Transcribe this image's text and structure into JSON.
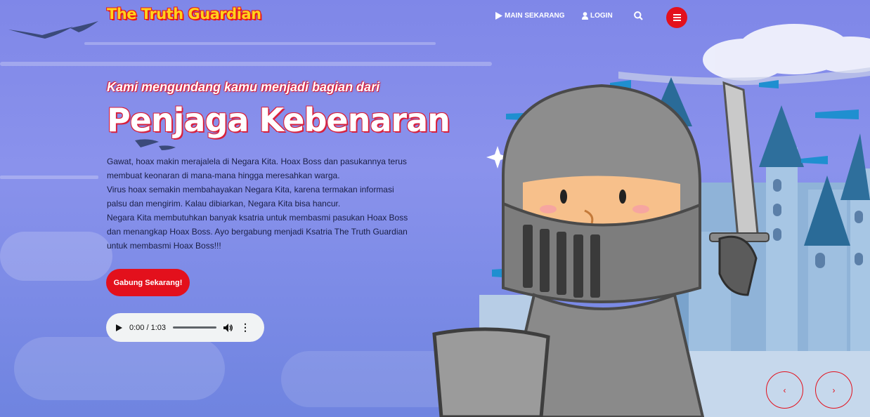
{
  "nav": {
    "logo": "The Truth Guardian",
    "play_label": "MAIN SEKARANG",
    "login_label": "LOGIN"
  },
  "hero": {
    "subtitle": "Kami mengundang kamu menjadi bagian dari",
    "title": "Penjaga Kebenaran",
    "paragraphs": [
      "Gawat, hoax makin merajalela di Negara Kita. Hoax Boss dan pasukannya terus membuat keonaran di mana-mana hingga meresahkan warga.",
      "Virus hoax semakin membahayakan Negara Kita, karena termakan informasi palsu dan mengirim. Kalau dibiarkan, Negara Kita bisa hancur.",
      "Negara Kita membutuhkan banyak ksatria untuk membasmi pasukan Hoax Boss dan menangkap Hoax Boss. Ayo bergabung menjadi Ksatria The Truth Guardian untuk membasmi Hoax Boss!!!"
    ],
    "cta_label": "Gabung Sekarang!"
  },
  "audio": {
    "time": "0:00 / 1:03",
    "progress": 0
  },
  "colors": {
    "accent": "#e3101c",
    "logo_yellow": "#ffd21c",
    "sky": "#8088e8"
  },
  "icons": {
    "play": "play-icon",
    "user": "user-icon",
    "search": "search-icon",
    "menu": "hamburger-icon",
    "prev": "chevron-left-icon",
    "next": "chevron-right-icon"
  }
}
